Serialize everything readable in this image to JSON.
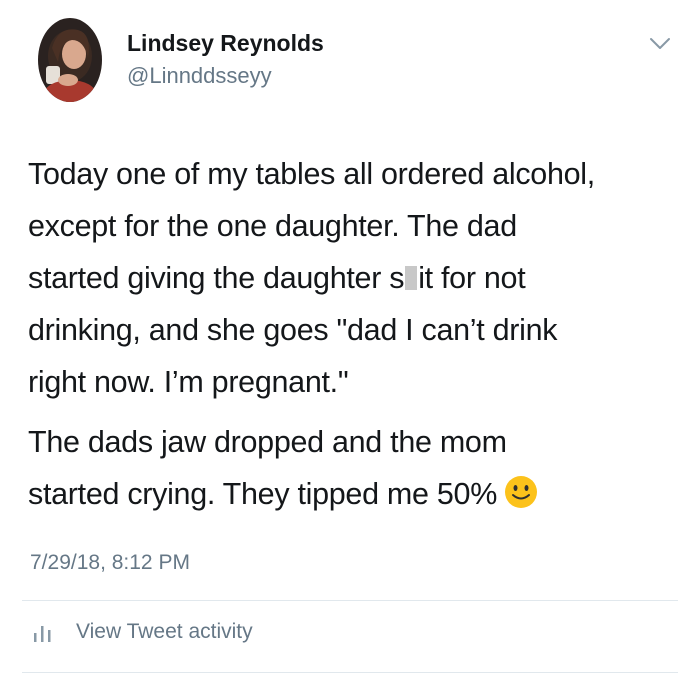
{
  "author": {
    "display_name": "Lindsey Reynolds",
    "handle": "@Linnddsseyy"
  },
  "tweet": {
    "paragraph1": {
      "line1": "Today one of my tables all ordered alcohol,",
      "line2": "except for the one daughter. The dad",
      "line3_before_censor": "started giving the daughter s",
      "line3_after_censor": "it for not",
      "line4": "drinking, and she goes \"dad I can’t drink",
      "line5": "right now. I’m pregnant.\""
    },
    "paragraph2": {
      "line1": "The dads jaw dropped and the mom",
      "line2": "started crying. They tipped me 50%"
    },
    "emoji": "slightly-smiling-face-icon",
    "timestamp": "7/29/18, 8:12 PM"
  },
  "actions": {
    "activity_label": "View Tweet activity",
    "activity_icon": "bar-chart-icon"
  },
  "colors": {
    "text_primary": "#14171a",
    "text_secondary": "#657786",
    "divider": "#e1e8ed",
    "emoji_face": "#fcc21b"
  }
}
